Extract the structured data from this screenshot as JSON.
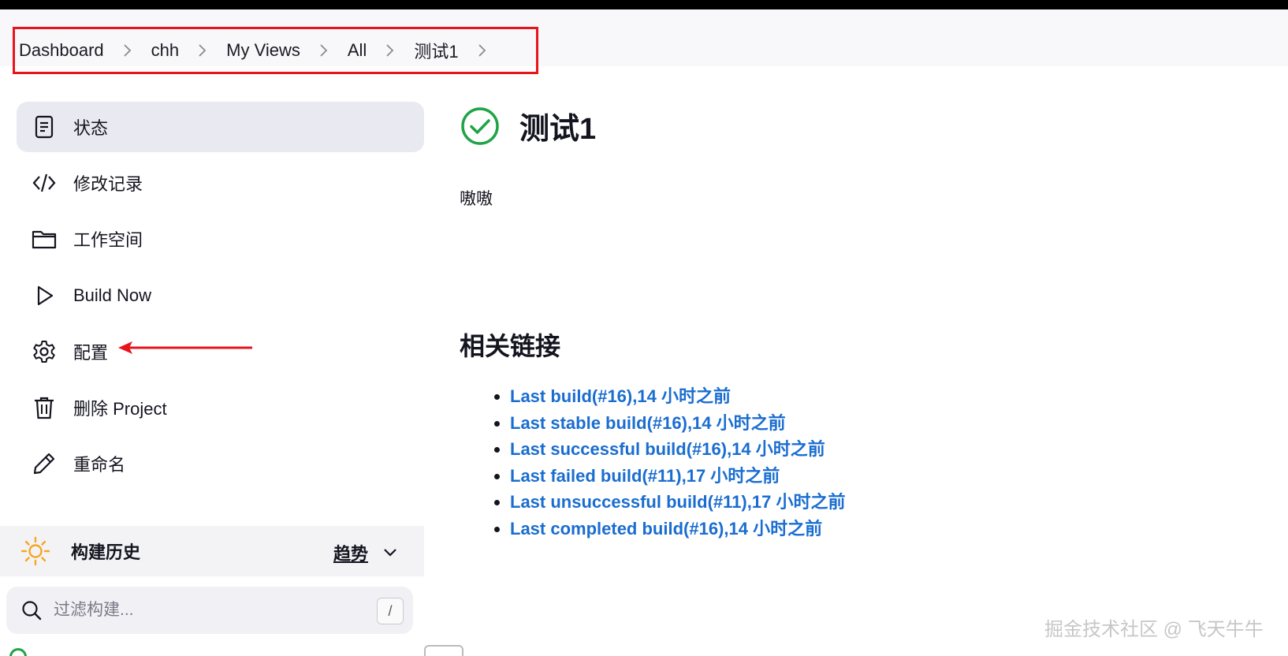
{
  "breadcrumb": {
    "items": [
      "Dashboard",
      "chh",
      "My Views",
      "All",
      "测试1"
    ]
  },
  "sidebar": {
    "tasks": [
      {
        "label": "状态",
        "icon": "document-icon"
      },
      {
        "label": "修改记录",
        "icon": "code-icon"
      },
      {
        "label": "工作空间",
        "icon": "folder-icon"
      },
      {
        "label": "Build Now",
        "icon": "play-icon"
      },
      {
        "label": "配置",
        "icon": "gear-icon"
      },
      {
        "label": "删除 Project",
        "icon": "trash-icon"
      },
      {
        "label": "重命名",
        "icon": "pencil-icon"
      }
    ],
    "history": {
      "title": "构建历史",
      "trend_label": "趋势",
      "filter_placeholder": "过滤构建...",
      "shortcut_key": "/"
    }
  },
  "main": {
    "job_title": "测试1",
    "description": "嗷嗷",
    "related_links_title": "相关链接",
    "links": [
      "Last build(#16),14 小时之前",
      "Last stable build(#16),14 小时之前",
      "Last successful build(#16),14 小时之前",
      "Last failed build(#11),17 小时之前",
      "Last unsuccessful build(#11),17 小时之前",
      "Last completed build(#16),14 小时之前"
    ]
  },
  "watermark": "掘金技术社区 @ 飞天牛牛",
  "colors": {
    "link": "#1a6dd0",
    "success": "#1ea446",
    "highlight_border": "#e8141c",
    "sun": "#f5a623",
    "active_task_bg": "#e9e9f2"
  }
}
